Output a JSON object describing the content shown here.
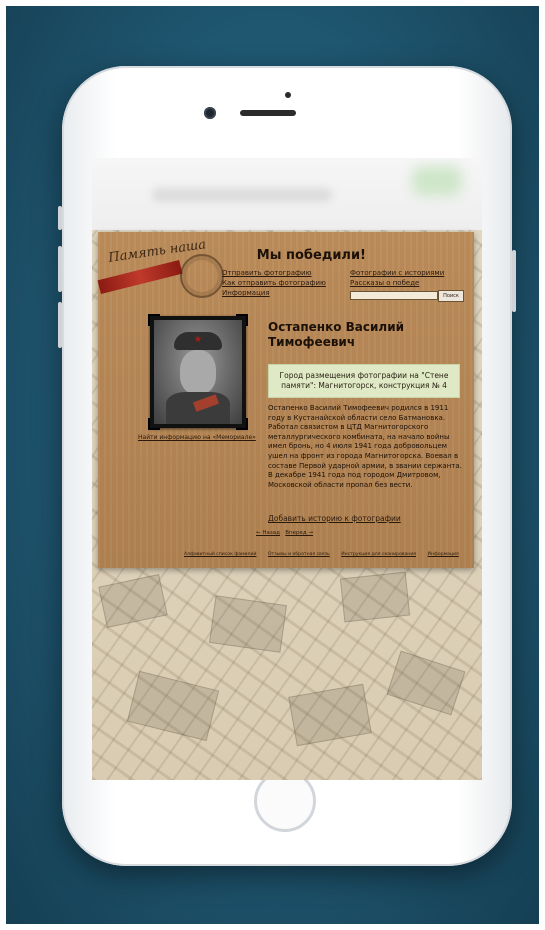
{
  "site": {
    "logo_text": "Память наша",
    "title": "Мы победили!"
  },
  "menu": {
    "left": [
      "Отправить фотографию",
      "Как отправить фотографию",
      "Информация"
    ],
    "right": [
      "Фотографии с историями",
      "Рассказы о победе"
    ]
  },
  "search": {
    "placeholder": "",
    "button": "Поиск"
  },
  "person": {
    "name": "Остапенко Василий Тимофеевич",
    "memorial_link": "Найти информацию на «Мемориале»",
    "location": "Город размещения фотографии на \"Стене памяти\": Магнитогорск, конструкция № 4",
    "bio": "Остапенко Василий Тимофеевич родился в 1911 году в Кустанайской области село Батмановка. Работал связистом в ЦТД Магнитогорского металлургического комбината, на начало войны имел бронь, но 4 июля 1941 года добровольцем ушел на фронт из города Магнитогорска. Воевал в составе Первой ударной армии, в звании сержанта. В декабре 1941 года под городом Дмитровом, Московской области пропал без вести.",
    "add_story": "Добавить историю к фотографии"
  },
  "pager": {
    "prev": "← Назад",
    "next": "Вперед →"
  },
  "footer": [
    "Алфавитный список фамилий",
    "Отзывы и обратная связь",
    "Инструкция для сканирования",
    "Информация"
  ],
  "colors": {
    "page_bg": "#b98a58",
    "location_box": "#dfe9c5",
    "backdrop": "#1f5670"
  }
}
